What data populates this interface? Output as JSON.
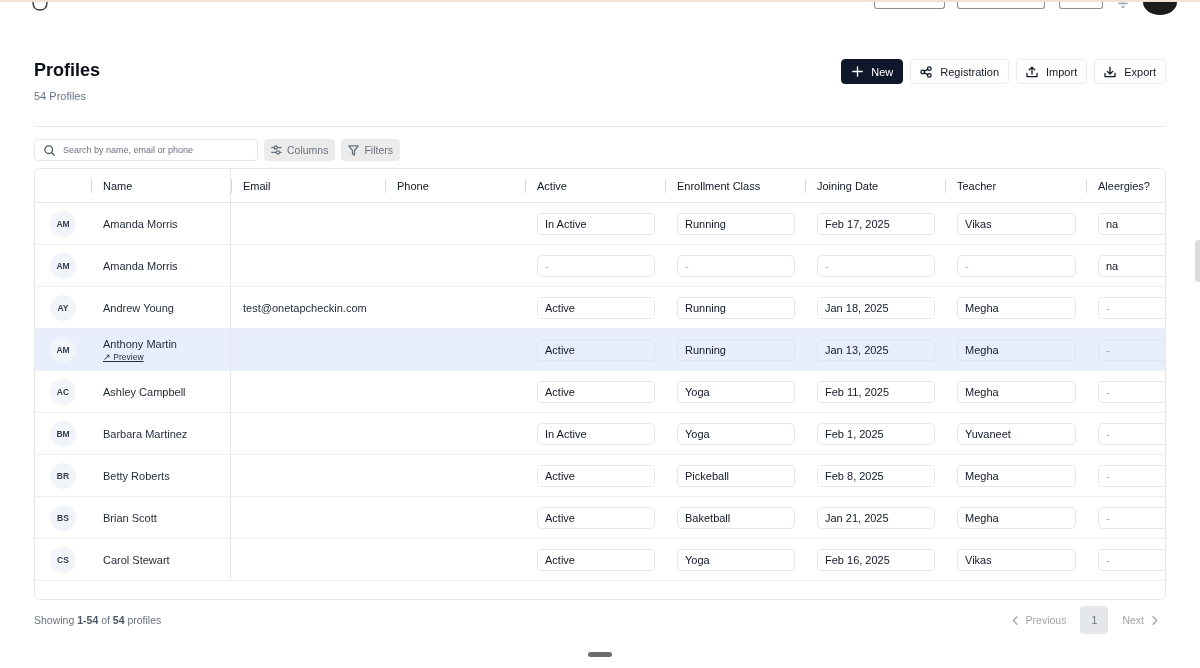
{
  "page": {
    "title": "Profiles",
    "subtitle": "54 Profiles",
    "actions": [
      {
        "label": "New",
        "kind": "primary"
      },
      {
        "label": "Registration",
        "kind": "secondary"
      },
      {
        "label": "Import",
        "kind": "secondary"
      },
      {
        "label": "Export",
        "kind": "secondary"
      }
    ]
  },
  "toolbar": {
    "search": {
      "placeholder": "Search by name, email or phone"
    },
    "buttons": [
      "Columns",
      "Filters"
    ]
  },
  "table": {
    "columns": [
      "Name",
      "Email",
      "Phone",
      "Active",
      "Enrollment Class",
      "Joining Date",
      "Teacher",
      "Aleergies?"
    ],
    "rows": [
      {
        "initials": "AM",
        "name": "Amanda Morris",
        "highlighted": false,
        "fields": [
          {
            "value": "In Active"
          },
          {
            "value": "Running"
          },
          {
            "value": "Feb 17, 2025"
          },
          {
            "value": "Vikas"
          },
          {
            "value": "na"
          }
        ]
      },
      {
        "initials": "AM",
        "name": "Amanda Morris",
        "highlighted": false,
        "fields": [
          {
            "placeholder": "-"
          },
          {
            "placeholder": "-"
          },
          {
            "placeholder": "-"
          },
          {
            "placeholder": "-"
          },
          {
            "value": "na"
          }
        ]
      },
      {
        "initials": "AY",
        "name": "Andrew Young",
        "email": "test@onetapcheckin.com",
        "highlighted": false,
        "fields": [
          {
            "value": "Active"
          },
          {
            "value": "Running"
          },
          {
            "value": "Jan 18, 2025"
          },
          {
            "value": "Megha"
          },
          {
            "placeholder": "-"
          }
        ]
      },
      {
        "initials": "AM",
        "name": "Anthony Martin",
        "preview": "↗ Preview",
        "highlighted": true,
        "fields": [
          {
            "value": "Active"
          },
          {
            "value": "Running"
          },
          {
            "value": "Jan 13, 2025"
          },
          {
            "value": "Megha"
          },
          {
            "placeholder": "-"
          }
        ]
      },
      {
        "initials": "AC",
        "name": "Ashley Campbell",
        "highlighted": false,
        "fields": [
          {
            "value": "Active"
          },
          {
            "value": "Yoga"
          },
          {
            "value": "Feb 11, 2025"
          },
          {
            "value": "Megha"
          },
          {
            "placeholder": "-"
          }
        ]
      },
      {
        "initials": "BM",
        "name": "Barbara Martinez",
        "highlighted": false,
        "fields": [
          {
            "value": "In Active"
          },
          {
            "value": "Yoga"
          },
          {
            "value": "Feb 1, 2025"
          },
          {
            "value": "Yuvaneet"
          },
          {
            "placeholder": "-"
          }
        ]
      },
      {
        "initials": "BR",
        "name": "Betty Roberts",
        "highlighted": false,
        "fields": [
          {
            "value": "Active"
          },
          {
            "value": "Pickeball"
          },
          {
            "value": "Feb 8, 2025"
          },
          {
            "value": "Megha"
          },
          {
            "placeholder": "-"
          }
        ]
      },
      {
        "initials": "BS",
        "name": "Brian Scott",
        "highlighted": false,
        "fields": [
          {
            "value": "Active"
          },
          {
            "value": "Baketball"
          },
          {
            "value": "Jan 21, 2025"
          },
          {
            "value": "Megha"
          },
          {
            "placeholder": "-"
          }
        ]
      },
      {
        "initials": "CS",
        "name": "Carol Stewart",
        "highlighted": false,
        "fields": [
          {
            "value": "Active"
          },
          {
            "value": "Yoga"
          },
          {
            "value": "Feb 16, 2025"
          },
          {
            "value": "Vikas"
          },
          {
            "placeholder": "-"
          }
        ]
      }
    ]
  },
  "footer": {
    "summary": "Showing **1-54** of **54** profiles",
    "pagination": {
      "previous": {
        "label": "Previous",
        "disabled": true
      },
      "pages": [
        {
          "label": "1",
          "selected": true
        }
      ],
      "next": {
        "label": "Next",
        "disabled": true
      }
    }
  }
}
